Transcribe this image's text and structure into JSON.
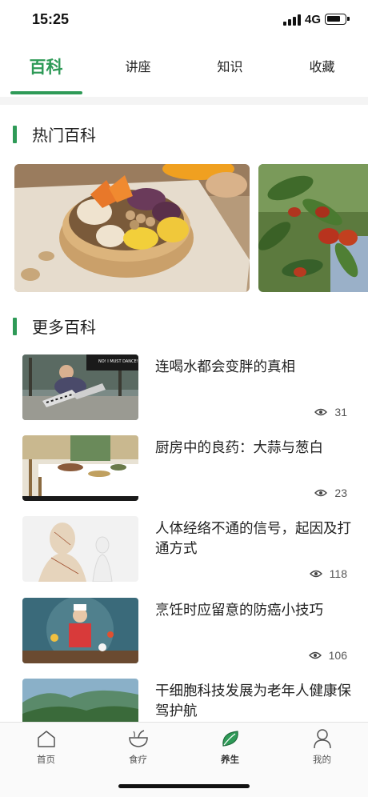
{
  "status_bar": {
    "time": "15:25",
    "network": "4G"
  },
  "tabs": [
    {
      "label": "百科",
      "active": true
    },
    {
      "label": "讲座",
      "active": false
    },
    {
      "label": "知识",
      "active": false
    },
    {
      "label": "收藏",
      "active": false
    }
  ],
  "hot_section": {
    "title": "热门百科"
  },
  "more_section": {
    "title": "更多百科"
  },
  "articles": [
    {
      "title": "连喝水都会变胖的真相",
      "views": "31",
      "thumb_caption": "NO! I MUST DANCE!"
    },
    {
      "title": "厨房中的良药：大蒜与葱白",
      "views": "23"
    },
    {
      "title": "人体经络不通的信号，起因及打通方式",
      "views": "118"
    },
    {
      "title": "烹饪时应留意的防癌小技巧",
      "views": "106"
    },
    {
      "title": "干细胞科技发展为老年人健康保驾护航",
      "views": ""
    }
  ],
  "bottom_nav": [
    {
      "label": "首页",
      "icon": "house-icon",
      "active": false
    },
    {
      "label": "食疗",
      "icon": "bowl-icon",
      "active": false
    },
    {
      "label": "养生",
      "icon": "leaf-icon",
      "active": true
    },
    {
      "label": "我的",
      "icon": "user-icon",
      "active": false
    }
  ],
  "colors": {
    "accent": "#2e9a57",
    "text": "#222222",
    "muted": "#555555"
  }
}
